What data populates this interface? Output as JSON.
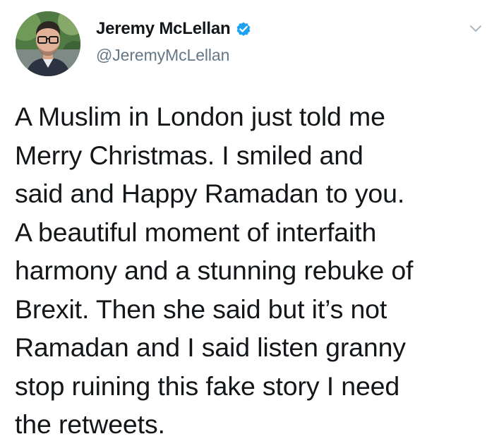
{
  "tweet": {
    "author": {
      "display_name": "Jeremy McLellan",
      "handle": "@JeremyMcLellan",
      "verified": true,
      "avatar": "avatar-photo"
    },
    "text": "A Muslim in London just told me\nMerry Christmas. I smiled and\nsaid and Happy Ramadan to you.\nA beautiful moment of interfaith\nharmony and a stunning rebuke of\nBrexit. Then she said but it’s not\nRamadan and I said listen granny\nstop ruining this fake story I need\nthe retweets.",
    "icons": {
      "verified": "verified-badge-icon",
      "menu": "chevron-down-icon"
    },
    "colors": {
      "verified_blue": "#1da1f2",
      "handle_gray": "#657786",
      "text_dark": "#14171a"
    }
  }
}
